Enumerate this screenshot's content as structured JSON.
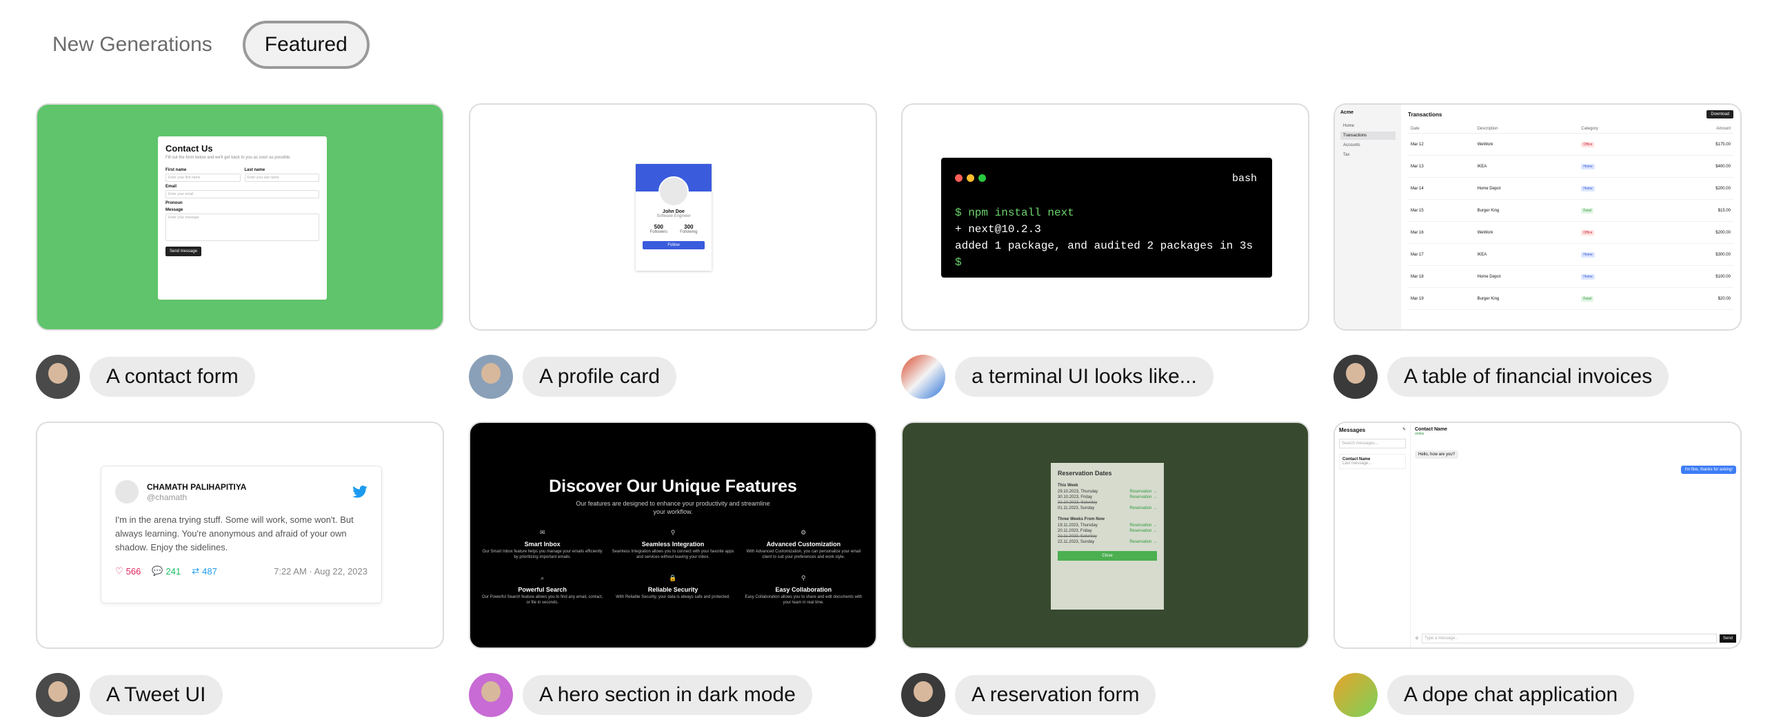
{
  "tabs": [
    {
      "label": "New Generations"
    },
    {
      "label": "Featured"
    }
  ],
  "cards": {
    "contact": {
      "caption": "A contact form",
      "title": "Contact Us",
      "subtitle": "Fill out the form below and we'll get back to you as soon as possible.",
      "first_name_label": "First name",
      "first_name_ph": "Enter your first name",
      "last_name_label": "Last name",
      "last_name_ph": "Enter your last name",
      "email_label": "Email",
      "email_ph": "Enter your email",
      "pronoun_label": "Pronoun",
      "message_label": "Message",
      "message_ph": "Enter your message",
      "send": "Send message"
    },
    "profile": {
      "caption": "A profile card",
      "name": "John Doe",
      "role": "Software Engineer",
      "followers_value": "500",
      "followers_label": "Followers",
      "following_value": "300",
      "following_label": "Following",
      "button": "Follow"
    },
    "terminal": {
      "caption": "a terminal UI looks like...",
      "title": "bash",
      "line1": "$ npm install next",
      "line2": "+ next@10.2.3",
      "line3": "added 1 package, and audited 2 packages in 3s",
      "line4": "$"
    },
    "invoices": {
      "caption": "A table of financial invoices",
      "brand": "Acme",
      "nav": [
        "Home",
        "Transactions",
        "Accounts",
        "Tax"
      ],
      "title": "Transactions",
      "download": "Download",
      "headers": [
        "Date",
        "Description",
        "Category",
        "Amount"
      ],
      "rows": [
        {
          "date": "Mar 12",
          "desc": "WeWork",
          "cat": "Office",
          "amt": "$175.00"
        },
        {
          "date": "Mar 13",
          "desc": "IKEA",
          "cat": "Home",
          "amt": "$400.00"
        },
        {
          "date": "Mar 14",
          "desc": "Home Depot",
          "cat": "Home",
          "amt": "$200.00"
        },
        {
          "date": "Mar 15",
          "desc": "Burger King",
          "cat": "Food",
          "amt": "$15.00"
        },
        {
          "date": "Mar 16",
          "desc": "WeWork",
          "cat": "Office",
          "amt": "$200.00"
        },
        {
          "date": "Mar 17",
          "desc": "IKEA",
          "cat": "Home",
          "amt": "$300.00"
        },
        {
          "date": "Mar 18",
          "desc": "Home Depot",
          "cat": "Home",
          "amt": "$100.00"
        },
        {
          "date": "Mar 19",
          "desc": "Burger King",
          "cat": "Food",
          "amt": "$20.00"
        }
      ]
    },
    "tweet": {
      "caption": "A Tweet UI",
      "name": "CHAMATH PALIHAPITIYA",
      "handle": "@chamath",
      "text": "I'm in the arena trying stuff. Some will work, some won't. But always learning. You're anonymous and afraid of your own shadow. Enjoy the sidelines.",
      "likes": "566",
      "replies": "241",
      "retweets": "487",
      "time": "7:22 AM · Aug 22, 2023"
    },
    "hero": {
      "caption": "A hero section in dark mode",
      "title": "Discover Our Unique Features",
      "subtitle": "Our features are designed to enhance your productivity and streamline your workflow.",
      "features": [
        {
          "icon": "✉",
          "title": "Smart Inbox",
          "text": "Our Smart Inbox feature helps you manage your emails efficiently by prioritizing important emails."
        },
        {
          "icon": "⚲",
          "title": "Seamless Integration",
          "text": "Seamless Integration allows you to connect with your favorite apps and services without leaving your inbox."
        },
        {
          "icon": "⚙",
          "title": "Advanced Customization",
          "text": "With Advanced Customization, you can personalize your email client to suit your preferences and work style."
        },
        {
          "icon": "⌕",
          "title": "Powerful Search",
          "text": "Our Powerful Search feature allows you to find any email, contact, or file in seconds."
        },
        {
          "icon": "🔒",
          "title": "Reliable Security",
          "text": "With Reliable Security, your data is always safe and protected."
        },
        {
          "icon": "⚲",
          "title": "Easy Collaboration",
          "text": "Easy Collaboration allows you to share and edit documents with your team in real time."
        }
      ]
    },
    "reservation": {
      "caption": "A reservation form",
      "title": "Reservation Dates",
      "section1": "This Week",
      "week": [
        {
          "date": "29.10.2023, Thursday",
          "label": "Reservation →",
          "strike": false
        },
        {
          "date": "30.10.2023, Friday",
          "label": "Reservation →",
          "strike": false
        },
        {
          "date": "31.10.2023, Saturday",
          "label": "",
          "strike": true
        },
        {
          "date": "01.11.2023, Sunday",
          "label": "Reservation →",
          "strike": false
        }
      ],
      "section2": "Three Weeks From Now",
      "later": [
        {
          "date": "19.11.2023, Thursday",
          "label": "Reservation →",
          "strike": false
        },
        {
          "date": "20.11.2023, Friday",
          "label": "Reservation →",
          "strike": false
        },
        {
          "date": "21.11.2023, Saturday",
          "label": "",
          "strike": true
        },
        {
          "date": "22.11.2023, Sunday",
          "label": "Reservation →",
          "strike": false
        }
      ],
      "close": "Close"
    },
    "chat": {
      "caption": "A dope chat application",
      "messages_title": "Messages",
      "search_ph": "Search messages...",
      "contact_name": "Contact Name",
      "last_message": "Last message...",
      "header_name": "Contact Name",
      "status": "online",
      "msg_in": "Hello, how are you?",
      "msg_out": "I'm fine, thanks for asking!",
      "input_ph": "Type a message...",
      "send": "Send"
    }
  }
}
